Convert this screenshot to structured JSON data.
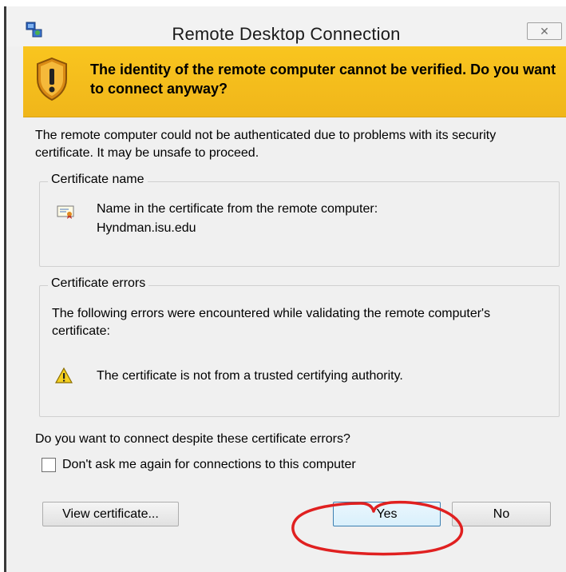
{
  "window": {
    "title": "Remote Desktop Connection",
    "close_glyph": "✕"
  },
  "banner": {
    "message": "The identity of the remote computer cannot be verified. Do you want to connect anyway?"
  },
  "intro_text": "The remote computer could not be authenticated due to problems with its security certificate. It may be unsafe to proceed.",
  "certificate_name": {
    "group_label": "Certificate name",
    "line1": "Name in the certificate from the remote computer:",
    "line2": "Hyndman.isu.edu"
  },
  "certificate_errors": {
    "group_label": "Certificate errors",
    "intro": "The following errors were encountered while validating the remote computer's certificate:",
    "error": "The certificate is not from a trusted certifying authority."
  },
  "question": "Do you want to connect despite these certificate errors?",
  "checkbox": {
    "label": "Don't ask me again for connections to this computer",
    "checked": false
  },
  "buttons": {
    "view": "View certificate...",
    "yes": "Yes",
    "no": "No"
  },
  "colors": {
    "banner": "#f6be1d",
    "annotation": "#e02020"
  }
}
